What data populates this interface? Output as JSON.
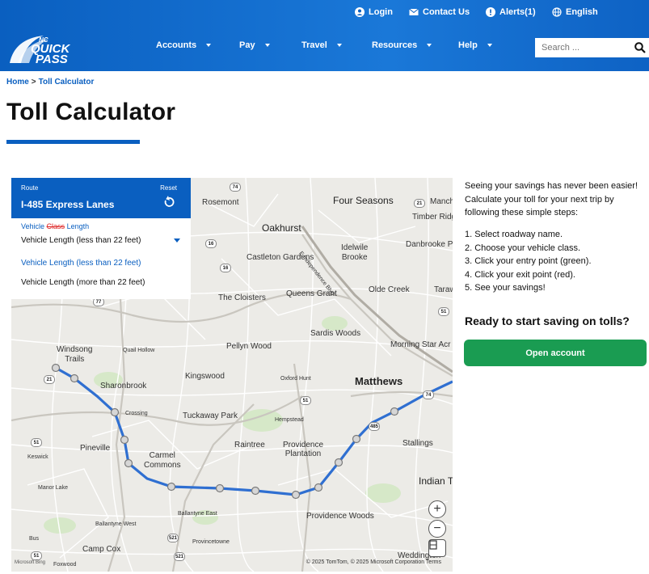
{
  "topbar": {
    "login": "Login",
    "contact": "Contact Us",
    "alerts": "Alerts(1)",
    "language": "English"
  },
  "logo": {
    "line1": "NC",
    "line2": "QUICK",
    "line3": "PASS"
  },
  "nav": {
    "items": [
      "Accounts",
      "Pay",
      "Travel",
      "Resources",
      "Help"
    ]
  },
  "search": {
    "placeholder": "Search ..."
  },
  "breadcrumb": {
    "home": "Home",
    "separator": ">",
    "current": "Toll Calculator"
  },
  "page": {
    "title": "Toll Calculator"
  },
  "route_panel": {
    "route_label": "Route",
    "reset_label": "Reset",
    "route_name": "I-485 Express Lanes",
    "vehicle_label_pre": "Vehicle",
    "vehicle_label_struck": "Class",
    "vehicle_label_post": "Length",
    "selected_value": "Vehicle Length (less than 22 feet)",
    "options": [
      "Vehicle Length (less than 22 feet)",
      "Vehicle Length (more than 22 feet)"
    ]
  },
  "map": {
    "labels": {
      "rosemont": "Rosemont",
      "four_seasons": "Four Seasons",
      "manch": "Manch",
      "timber_ridg": "Timber Ridg",
      "oakhurst": "Oakhurst",
      "independence": "E Independence Blvd",
      "idlewild": "Idelwile\nBrooke",
      "danbrooke": "Danbrooke P",
      "castleton": "Castleton Gardens",
      "olde_creek": "Olde Creek",
      "taraw": "Taraw",
      "cloisters": "The Cloisters",
      "queens_grant": "Queens Grant",
      "sardis_woods": "Sardis Woods",
      "pellyn_wood": "Pellyn Wood",
      "morning_star": "Morning Star Acr",
      "windsong": "Windsong\nTrails",
      "quail_hollow": "Quail Hollow",
      "kingswood": "Kingswood",
      "oxford_hunt": "Oxford Hunt",
      "matthews": "Matthews",
      "sharonbrook": "Sharonbrook",
      "crossing": "Crossing",
      "tuckaway": "Tuckaway Park",
      "hempstead": "Hempstead",
      "pineville": "Pineville",
      "raintree": "Raintree",
      "providence_plantation": "Providence\nPlantation",
      "stallings": "Stallings",
      "keswick": "Keswick",
      "carmel_commons": "Carmel\nCommons",
      "indian": "Indian T",
      "manor_lake": "Manor Lake",
      "ballantyne_east": "Ballantyne East",
      "providence_woods": "Providence Woods",
      "ballantyne_west": "Ballantyne West",
      "provincetowne": "Provincetowne",
      "camp_cox": "Camp Cox",
      "bus": "Bus",
      "foxwood": "Foxwood",
      "weddington": "Weddington"
    },
    "shields": [
      "74",
      "16",
      "16",
      "77",
      "21",
      "51",
      "51",
      "74",
      "485",
      "51",
      "521",
      "521",
      "21",
      "51"
    ],
    "attribution": "© 2025 TomTom, © 2025 Microsoft Corporation  Terms",
    "ms_logo": "Microsoft Bing"
  },
  "info": {
    "intro": "Seeing your savings has never been easier! Calculate your toll for your next trip by following these simple steps:",
    "steps": [
      "1.  Select roadway name.",
      "2.  Choose your vehicle class.",
      "3.  Click your entry point (green).",
      "4.  Click your exit point (red).",
      "5.  See your savings!"
    ],
    "cta_title": "Ready to start saving on tolls?",
    "cta_button": "Open account"
  },
  "colors": {
    "brand_blue": "#0a5fc0",
    "route_blue": "#2f6fd1",
    "cta_green": "#1a9c52"
  }
}
